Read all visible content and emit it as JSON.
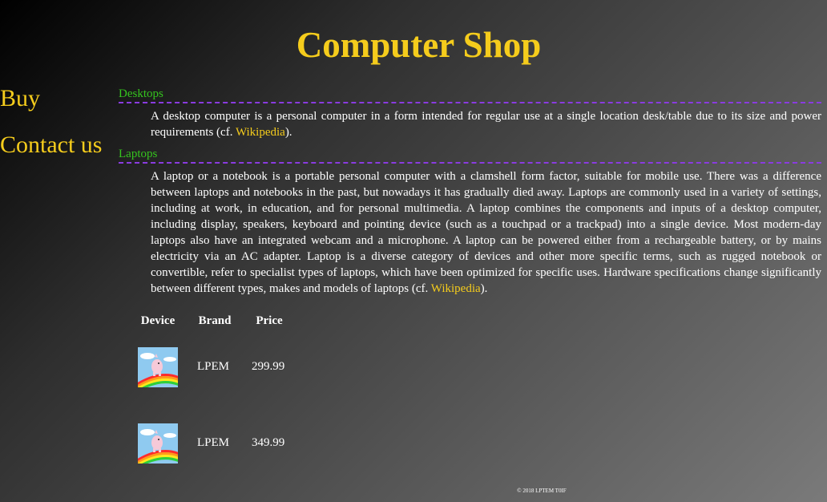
{
  "header": {
    "title": "Computer Shop"
  },
  "nav": [
    {
      "label": "Buy"
    },
    {
      "label": "Contact us"
    }
  ],
  "sections": {
    "desktops": {
      "heading": "Desktops",
      "text": "A desktop computer is a personal computer in a form intended for regular use at a single location desk/table due to its size and power requirements (cf. ",
      "link": "Wikipedia",
      "after": ")."
    },
    "laptops": {
      "heading": "Laptops",
      "text": "A laptop or a notebook is a portable personal computer with a clamshell form factor, suitable for mobile use. There was a difference between laptops and notebooks in the past, but nowadays it has gradually died away. Laptops are commonly used in a variety of settings, including at work, in education, and for personal multimedia. A laptop combines the components and inputs of a desktop computer, including display, speakers, keyboard and pointing device (such as a touchpad or a trackpad) into a single device. Most modern-day laptops also have an integrated webcam and a microphone. A laptop can be powered either from a rechargeable battery, or by mains electricity via an AC adapter. Laptop is a diverse category of devices and other more specific terms, such as rugged notebook or convertible, refer to specialist types of laptops, which have been optimized for specific uses. Hardware specifications change significantly between different types, makes and models of laptops (cf. ",
      "link": "Wikipedia",
      "after": ")."
    }
  },
  "table": {
    "headers": [
      "Device",
      "Brand",
      "Price"
    ],
    "rows": [
      {
        "brand": "LPEM",
        "price": "299.99"
      },
      {
        "brand": "LPEM",
        "price": "349.99"
      }
    ]
  },
  "footer": {
    "text": "© 2018 LPTEM T0IF"
  },
  "colors": {
    "title": "#f5cc1c",
    "heading": "#35c41e",
    "divider": "#8a3be0"
  }
}
